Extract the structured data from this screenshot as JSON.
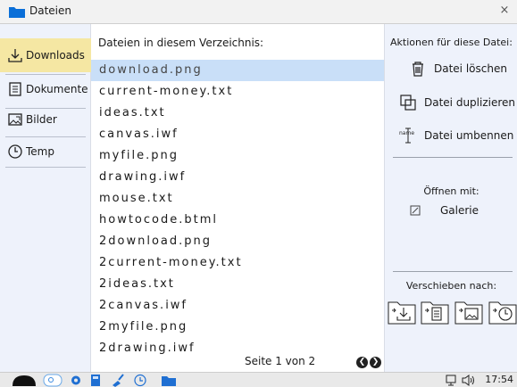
{
  "window": {
    "title": "Dateien",
    "close": "×"
  },
  "sidebar": {
    "items": [
      {
        "label": "Downloads",
        "icon": "download-icon",
        "active": true
      },
      {
        "label": "Dokumente",
        "icon": "document-icon",
        "active": false
      },
      {
        "label": "Bilder",
        "icon": "image-icon",
        "active": false
      },
      {
        "label": "Temp",
        "icon": "clock-icon",
        "active": false
      }
    ]
  },
  "main": {
    "heading": "Dateien in diesem Verzeichnis:",
    "files": [
      "download.png",
      "current-money.txt",
      "ideas.txt",
      "canvas.iwf",
      "myfile.png",
      "drawing.iwf",
      "mouse.txt",
      "howtocode.btml",
      "2download.png",
      "2current-money.txt",
      "2ideas.txt",
      "2canvas.iwf",
      "2myfile.png",
      "2drawing.iwf"
    ],
    "selected_index": 0,
    "pager": "Seite 1 von 2"
  },
  "actions": {
    "heading": "Aktionen für diese Datei:",
    "delete": "Datei löschen",
    "duplicate": "Datei duplizieren",
    "rename": "Datei umbennen",
    "rename_icon_text": "name",
    "open_with": "Öffnen mit:",
    "gallery": "Galerie",
    "move_to": "Verschieben nach:"
  },
  "taskbar": {
    "time": "17:54"
  },
  "colors": {
    "accent": "#0b6fd8",
    "selected_row": "#c9dff8",
    "active_sidebar": "#f5e7a3",
    "panel_bg": "#eef2fb"
  }
}
